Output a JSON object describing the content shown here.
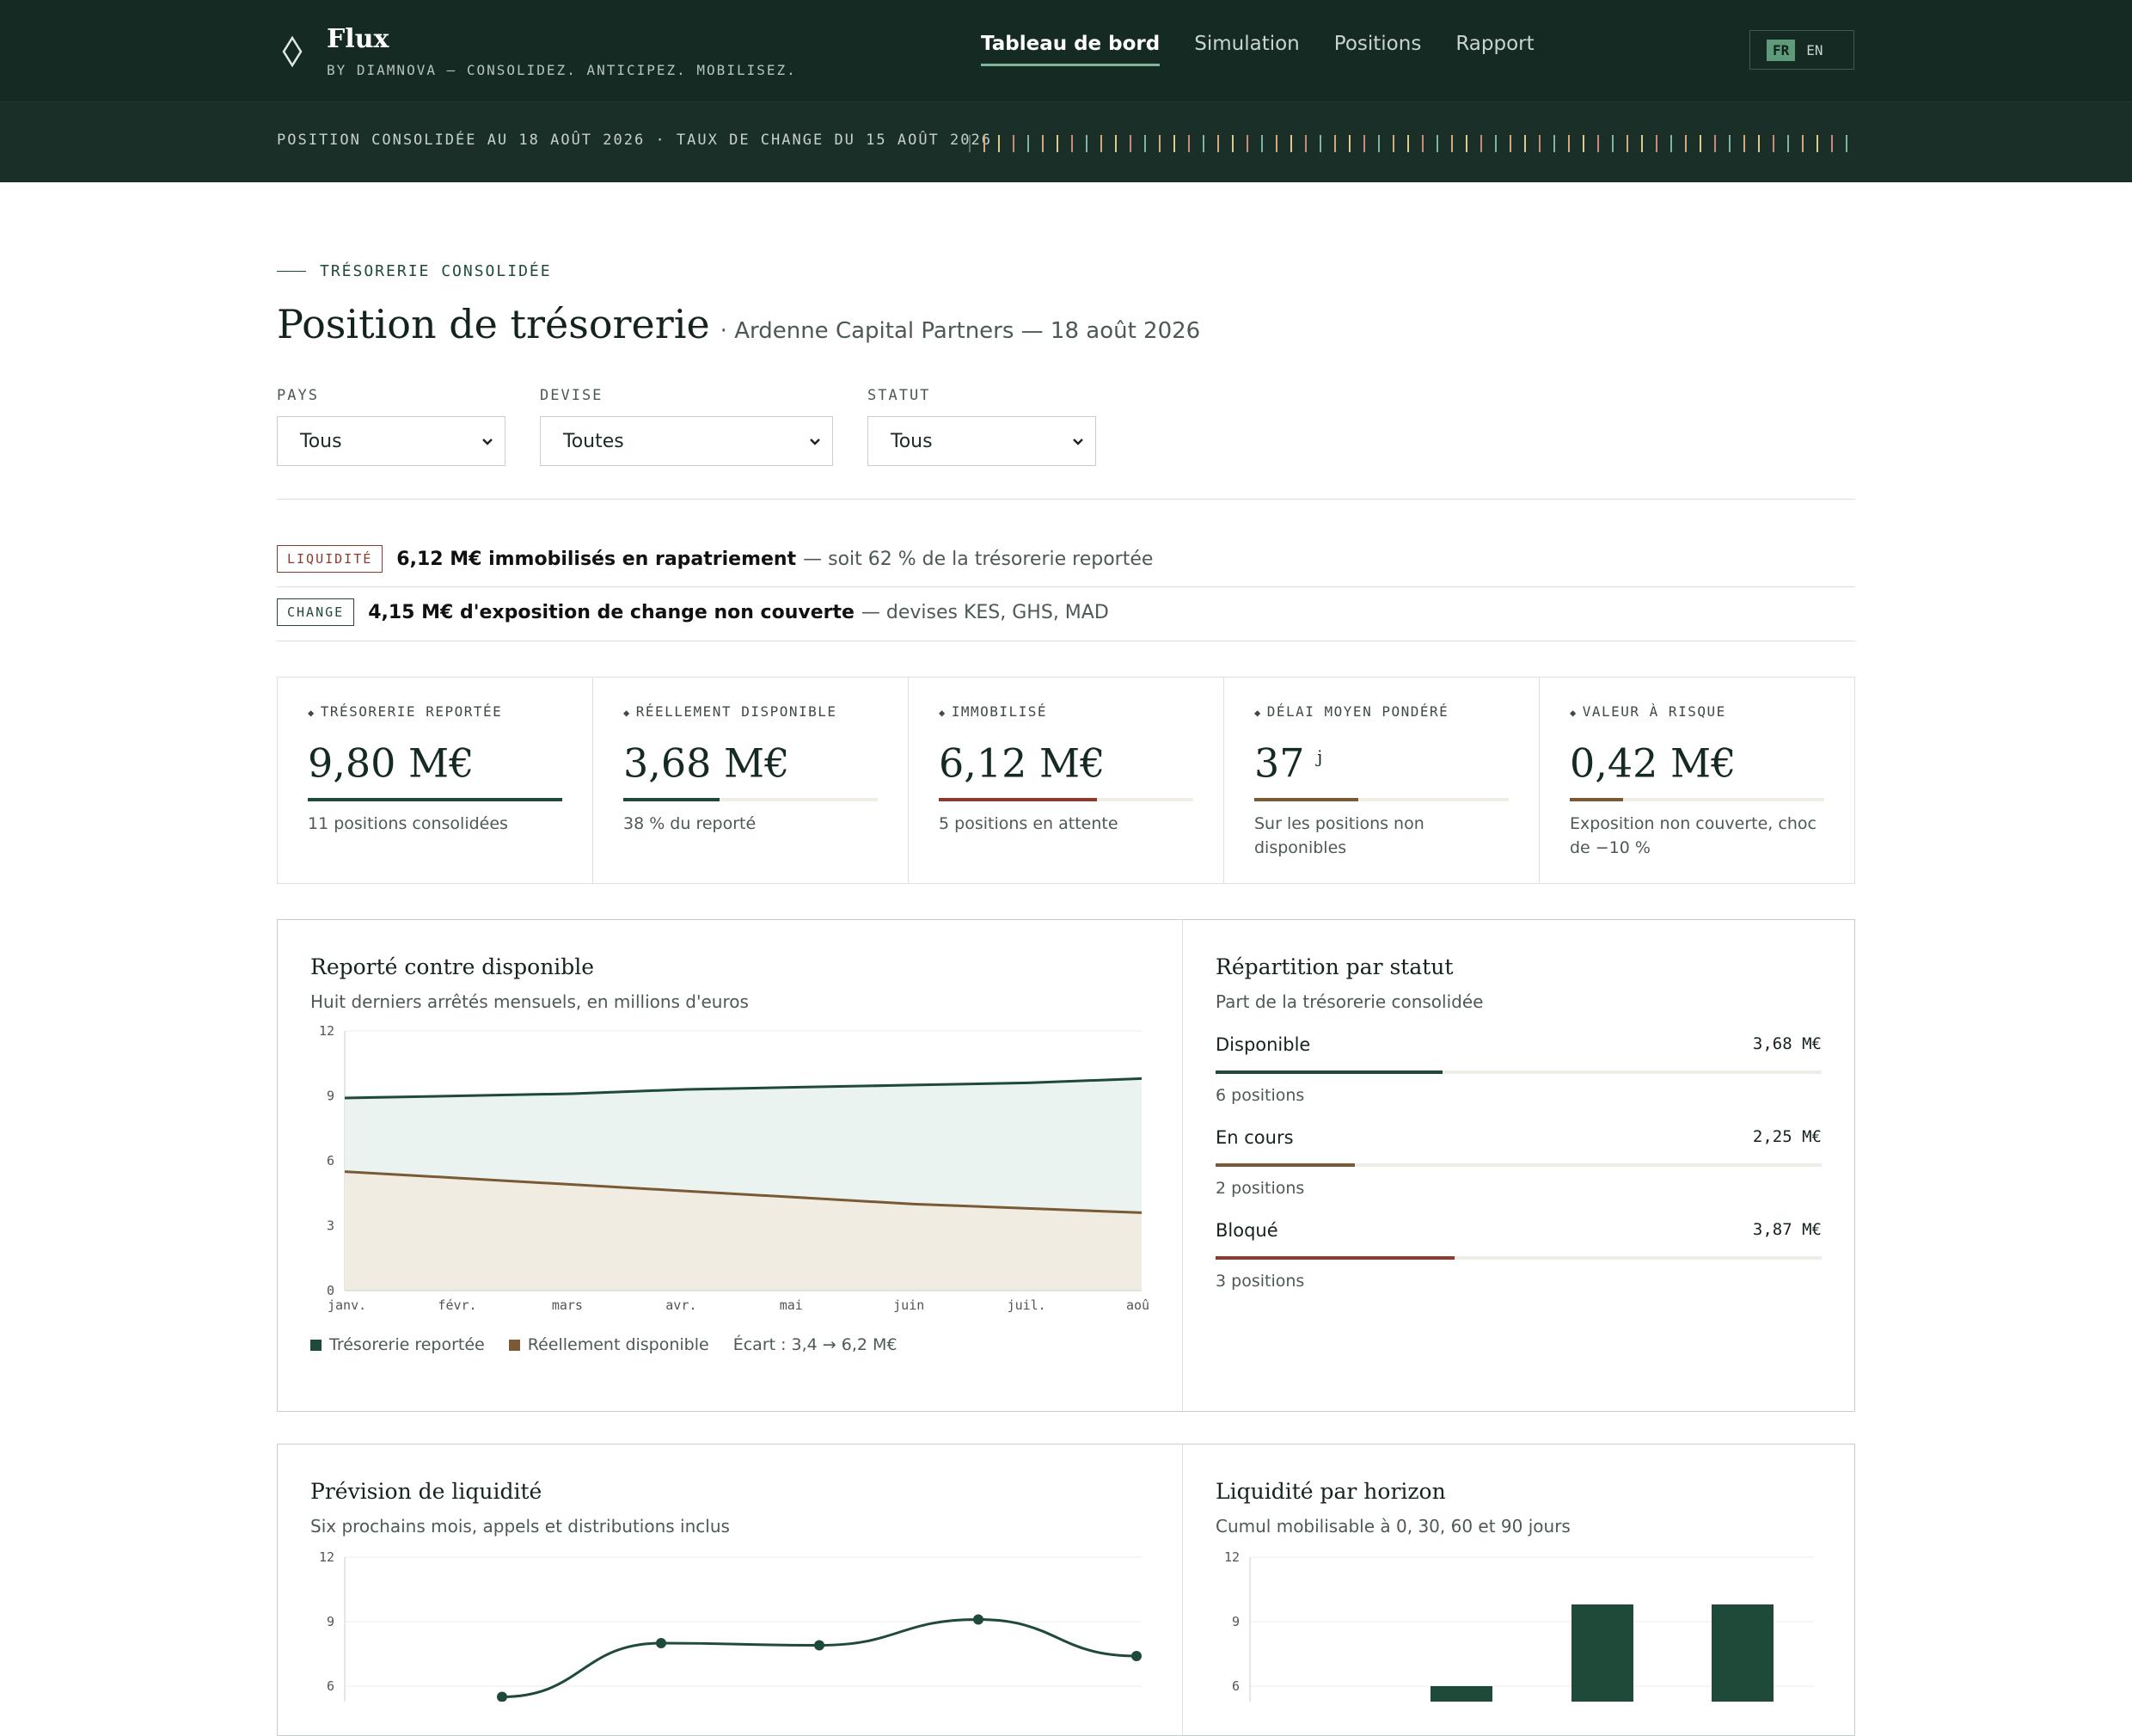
{
  "app": {
    "name": "Flux",
    "tagline": "BY DIAMNOVA — CONSOLIDEZ. ANTICIPEZ. MOBILISEZ."
  },
  "nav": {
    "items": [
      "Tableau de bord",
      "Simulation",
      "Positions",
      "Rapport"
    ],
    "active": 0
  },
  "lang": {
    "fr": "FR",
    "en": "EN",
    "active": "FR"
  },
  "ticker": {
    "text": "POSITION CONSOLIDÉE AU 18 AOÛT 2026 · TAUX DE CHANGE DU 15 AOÛT 2026"
  },
  "section": {
    "eyebrow": "TRÉSORERIE CONSOLIDÉE",
    "title": "Position de trésorerie",
    "subtitle": "· Ardenne Capital Partners — 18 août 2026"
  },
  "filters": [
    {
      "label": "PAYS",
      "value": "Tous"
    },
    {
      "label": "DEVISE",
      "value": "Toutes"
    },
    {
      "label": "STATUT",
      "value": "Tous"
    }
  ],
  "alerts": [
    {
      "badge": "LIQUIDITÉ",
      "strong": "6,12 M€ immobilisés en rapatriement",
      "rest": "— soit 62 % de la trésorerie reportée"
    },
    {
      "badge": "CHANGE",
      "strong": "4,15 M€ d'exposition de change non couverte",
      "rest": "— devises KES, GHS, MAD"
    }
  ],
  "kpis": [
    {
      "label": "TRÉSORERIE REPORTÉE",
      "value": "9,80 M€",
      "unit": "",
      "note": "11 positions consolidées",
      "fill": 1.0,
      "color": "#1f4a3a"
    },
    {
      "label": "RÉELLEMENT DISPONIBLE",
      "value": "3,68 M€",
      "unit": "",
      "note": "38 % du reporté",
      "fill": 0.38,
      "color": "#1f4a3a"
    },
    {
      "label": "IMMOBILISÉ",
      "value": "6,12 M€",
      "unit": "",
      "note": "5 positions en attente",
      "fill": 0.62,
      "color": "#8a3b2e"
    },
    {
      "label": "DÉLAI MOYEN PONDÉRÉ",
      "value": "37",
      "unit": "j",
      "note": "Sur les positions non disponibles",
      "fill": 0.41,
      "color": "#7a5a34"
    },
    {
      "label": "VALEUR À RISQUE",
      "value": "0,42 M€",
      "unit": "",
      "note": "Exposition non couverte, choc de −10 %",
      "fill": 0.21,
      "color": "#7a5a34"
    }
  ],
  "panels": {
    "reported_vs_available": {
      "title": "Reporté contre disponible",
      "subtitle": "Huit derniers arrêtés mensuels, en millions d'euros",
      "legend": [
        "Trésorerie reportée",
        "Réellement disponible"
      ],
      "gap": "Écart : 3,4 → 6,2 M€"
    },
    "status": {
      "title": "Répartition par statut",
      "subtitle": "Part de la trésorerie consolidée",
      "rows": [
        {
          "name": "Disponible",
          "amount": "3,68 M€",
          "count": "6 positions",
          "fill": 0.375,
          "color": "#1f4a3a"
        },
        {
          "name": "En cours",
          "amount": "2,25 M€",
          "count": "2 positions",
          "fill": 0.23,
          "color": "#7a5a34"
        },
        {
          "name": "Bloqué",
          "amount": "3,87 M€",
          "count": "3 positions",
          "fill": 0.395,
          "color": "#8a3b2e"
        }
      ]
    },
    "forecast": {
      "title": "Prévision de liquidité",
      "subtitle": "Six prochains mois, appels et distributions inclus"
    },
    "horizon": {
      "title": "Liquidité par horizon",
      "subtitle": "Cumul mobilisable à 0, 30, 60 et 90 jours"
    }
  },
  "colors": {
    "green": "#1f4a3a",
    "brown": "#7a5a34",
    "red": "#8a3b2e",
    "header": "#152a22"
  },
  "chart_data": [
    {
      "type": "area",
      "categories": [
        "janv.",
        "févr.",
        "mars",
        "avr.",
        "mai",
        "juin",
        "juil.",
        "août"
      ],
      "series": [
        {
          "name": "Trésorerie reportée",
          "values": [
            8.9,
            9.0,
            9.1,
            9.3,
            9.4,
            9.5,
            9.6,
            9.8
          ]
        },
        {
          "name": "Réellement disponible",
          "values": [
            5.5,
            5.2,
            4.9,
            4.6,
            4.3,
            4.0,
            3.8,
            3.6
          ]
        }
      ],
      "yticks": [
        "0",
        "3",
        "6",
        "9",
        "12"
      ],
      "ylim": [
        0,
        12
      ]
    },
    {
      "type": "line",
      "points": [
        5.5,
        8.0,
        7.9,
        9.1,
        7.4
      ],
      "yticks": [
        "6",
        "9",
        "12"
      ],
      "ylim": [
        0,
        12
      ]
    },
    {
      "type": "bar",
      "values": [
        6.0,
        9.8,
        9.8
      ],
      "yticks": [
        "6",
        "9",
        "12"
      ],
      "ylim": [
        0,
        12
      ]
    }
  ]
}
